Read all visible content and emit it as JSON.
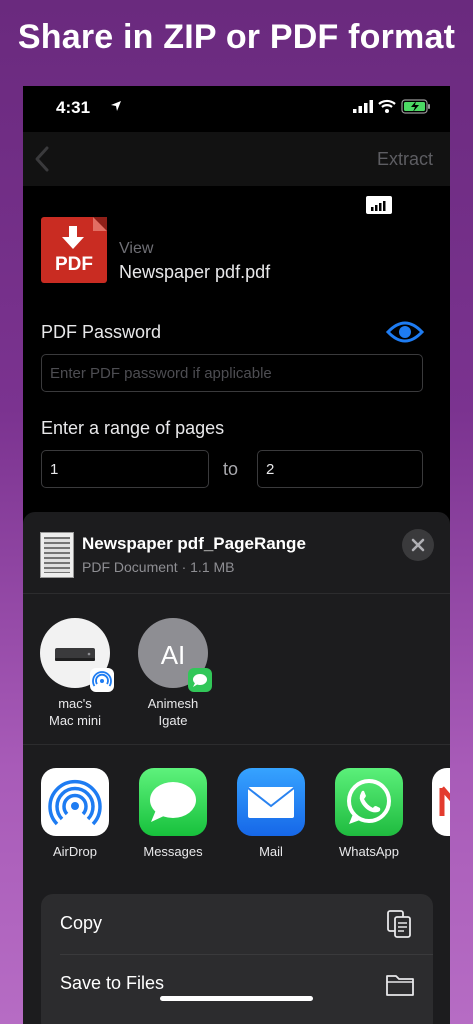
{
  "headline": "Share in ZIP or PDF format",
  "status": {
    "time": "4:31"
  },
  "nav": {
    "extract_label": "Extract"
  },
  "file": {
    "icon_text": "PDF",
    "view_label": "View",
    "name": "Newspaper pdf.pdf"
  },
  "password": {
    "label": "PDF Password",
    "placeholder": "Enter PDF password if applicable",
    "value": ""
  },
  "range": {
    "label": "Enter a range of pages",
    "from": "1",
    "to_label": "to",
    "to": "2"
  },
  "share_sheet": {
    "title": "Newspaper pdf_PageRange",
    "subtitle": "PDF Document · 1.1 MB",
    "people": [
      {
        "name_line1": "mac's",
        "name_line2": "Mac mini"
      },
      {
        "initials": "AI",
        "name_line1": "Animesh",
        "name_line2": "Igate"
      }
    ],
    "apps": [
      {
        "label": "AirDrop",
        "icon": "airdrop-icon"
      },
      {
        "label": "Messages",
        "icon": "messages-icon"
      },
      {
        "label": "Mail",
        "icon": "mail-icon"
      },
      {
        "label": "WhatsApp",
        "icon": "whatsapp-icon"
      }
    ],
    "actions": [
      {
        "label": "Copy",
        "icon": "copy-icon"
      },
      {
        "label": "Save to Files",
        "icon": "folder-icon"
      }
    ]
  },
  "colors": {
    "accent_blue": "#1e7cf2",
    "pdf_red": "#c92c22",
    "background_purple": "#7b3390"
  }
}
